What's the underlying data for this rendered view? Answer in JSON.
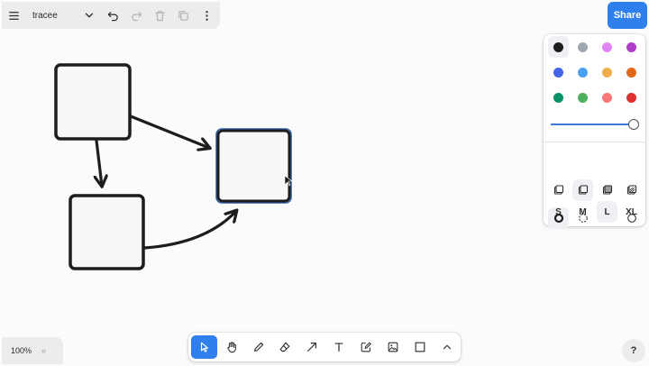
{
  "menu": {
    "document_name": "tracee",
    "main_menu_icon": "hamburger-icon",
    "page_dropdown_icon": "chevron-down-icon",
    "undo_icon": "undo-icon",
    "redo_icon": "redo-icon",
    "delete_icon": "trash-icon",
    "duplicate_icon": "duplicate-icon",
    "more_icon": "more-vertical-icon"
  },
  "share": {
    "label": "Share"
  },
  "style_panel": {
    "colors": [
      {
        "name": "black",
        "hex": "#1d1d1d",
        "selected": true
      },
      {
        "name": "grey",
        "hex": "#9fa8b2",
        "selected": false
      },
      {
        "name": "light-violet",
        "hex": "#e085f4",
        "selected": false
      },
      {
        "name": "violet",
        "hex": "#ae3ec9",
        "selected": false
      },
      {
        "name": "blue",
        "hex": "#4465e9",
        "selected": false
      },
      {
        "name": "light-blue",
        "hex": "#4ba1f1",
        "selected": false
      },
      {
        "name": "yellow",
        "hex": "#f1ac4b",
        "selected": false
      },
      {
        "name": "orange",
        "hex": "#e16919",
        "selected": false
      },
      {
        "name": "green",
        "hex": "#099268",
        "selected": false
      },
      {
        "name": "light-green",
        "hex": "#4cb05e",
        "selected": false
      },
      {
        "name": "light-red",
        "hex": "#f87777",
        "selected": false
      },
      {
        "name": "red",
        "hex": "#e03131",
        "selected": false
      }
    ],
    "opacity": 1.0,
    "fill_options": [
      {
        "name": "fill-none-icon",
        "selected": false
      },
      {
        "name": "fill-semi-icon",
        "selected": true
      },
      {
        "name": "fill-solid-icon",
        "selected": false
      },
      {
        "name": "fill-pattern-icon",
        "selected": false
      }
    ],
    "dash_options": [
      {
        "name": "dash-draw-icon",
        "selected": true
      },
      {
        "name": "dash-dashed-icon",
        "selected": false
      },
      {
        "name": "dash-dotted-icon",
        "selected": false
      },
      {
        "name": "dash-solid-icon",
        "selected": false
      }
    ],
    "sizes": [
      {
        "label": "S",
        "selected": false
      },
      {
        "label": "M",
        "selected": false
      },
      {
        "label": "L",
        "selected": true
      },
      {
        "label": "XL",
        "selected": false
      }
    ]
  },
  "zoom": {
    "level": "100%",
    "expand_label": "»"
  },
  "toolbar": {
    "tools": [
      {
        "name": "select-tool",
        "icon": "cursor-icon",
        "active": true
      },
      {
        "name": "hand-tool",
        "icon": "hand-icon",
        "active": false
      },
      {
        "name": "draw-tool",
        "icon": "pencil-icon",
        "active": false
      },
      {
        "name": "eraser-tool",
        "icon": "eraser-icon",
        "active": false
      },
      {
        "name": "arrow-tool",
        "icon": "arrow-icon",
        "active": false
      },
      {
        "name": "text-tool",
        "icon": "text-icon",
        "active": false
      },
      {
        "name": "note-tool",
        "icon": "note-icon",
        "active": false
      },
      {
        "name": "media-tool",
        "icon": "image-icon",
        "active": false
      },
      {
        "name": "rectangle-tool",
        "icon": "rectangle-icon",
        "active": false
      },
      {
        "name": "more-tools",
        "icon": "chevron-up-icon",
        "active": false
      }
    ]
  },
  "help": {
    "label": "?"
  },
  "canvas": {
    "shapes": [
      {
        "id": "box-a",
        "type": "rectangle"
      },
      {
        "id": "box-b",
        "type": "rectangle",
        "selected": true
      },
      {
        "id": "box-c",
        "type": "rectangle"
      }
    ],
    "arrows": [
      {
        "from": "box-a",
        "to": "box-b",
        "curved": false
      },
      {
        "from": "box-a",
        "to": "box-c",
        "curved": false
      },
      {
        "from": "box-c",
        "to": "box-b",
        "curved": true
      }
    ],
    "stroke_color": "#1d1d1d",
    "selection_color": "#2f5fa8"
  }
}
